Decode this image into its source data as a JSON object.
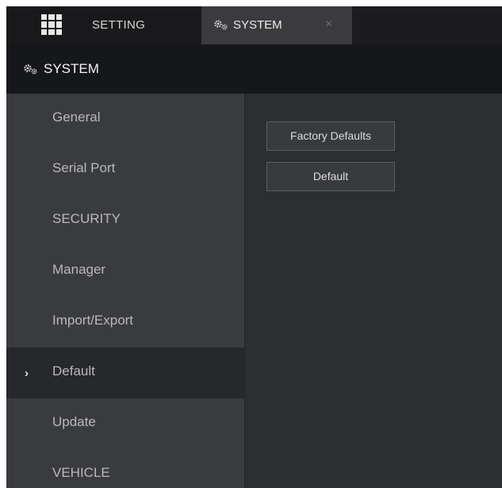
{
  "tabs": {
    "setting_label": "SETTING",
    "system_label": "SYSTEM",
    "close_glyph": "×"
  },
  "header": {
    "title": "SYSTEM"
  },
  "sidebar": {
    "items": [
      {
        "label": "General"
      },
      {
        "label": "Serial Port"
      },
      {
        "label": "SECURITY"
      },
      {
        "label": "Manager"
      },
      {
        "label": "Import/Export"
      },
      {
        "label": "Default",
        "active": true
      },
      {
        "label": "Update"
      },
      {
        "label": "VEHICLE"
      }
    ],
    "active_arrow": "›"
  },
  "content": {
    "factory_defaults_label": "Factory Defaults",
    "default_label": "Default"
  },
  "colors": {
    "background": "#2a2c2f",
    "tabbar": "#1c1c1e",
    "active_tab": "#3b3b3e",
    "header": "#16171a",
    "sidebar": "#3a3b3e",
    "sidebar_active": "#27282b",
    "button_border": "#5c5d61"
  },
  "icons": {
    "app_menu": "grid-icon",
    "system": "gears-icon",
    "close": "close-icon",
    "active_item": "chevron-right-icon"
  }
}
